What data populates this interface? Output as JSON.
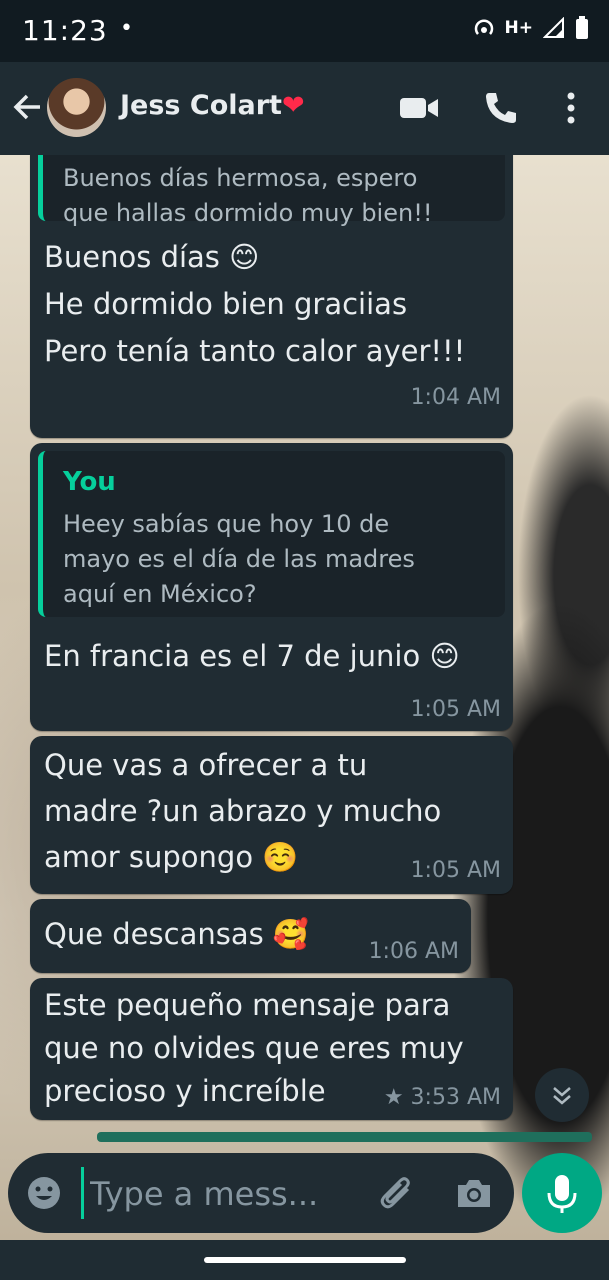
{
  "status": {
    "time": "11:23",
    "dot": "•",
    "network": "H+"
  },
  "header": {
    "contact_name": "Jess Colart",
    "heart": "❤"
  },
  "messages": [
    {
      "quote_text_lines": [
        "Buenos días hermosa, espero",
        "que hallas dormido muy bien!!"
      ],
      "text_lines": [
        "Buenos días 😊",
        "He dormido bien graciias",
        "Pero tenía tanto calor ayer!!!"
      ],
      "time": "1:04 AM"
    },
    {
      "quote_author": "You",
      "quote_text_lines": [
        "Heey sabías que hoy 10 de",
        "mayo es el día de las madres",
        "aquí en México?"
      ],
      "text_lines": [
        "En francia es el 7 de junio 😊"
      ],
      "time": "1:05 AM"
    },
    {
      "text_lines": [
        "Que vas a ofrecer a tu",
        "madre ?un abrazo y mucho",
        "amor supongo ☺️"
      ],
      "time": "1:05 AM"
    },
    {
      "text_lines": [
        "Que descansas 🥰"
      ],
      "time": "1:06 AM"
    },
    {
      "text_lines": [
        "Este pequeño mensaje para",
        "que no olvides que eres muy",
        "precioso y increíble"
      ],
      "time": "★ 3:53 AM"
    }
  ],
  "composer": {
    "placeholder": "Type a mess..."
  }
}
